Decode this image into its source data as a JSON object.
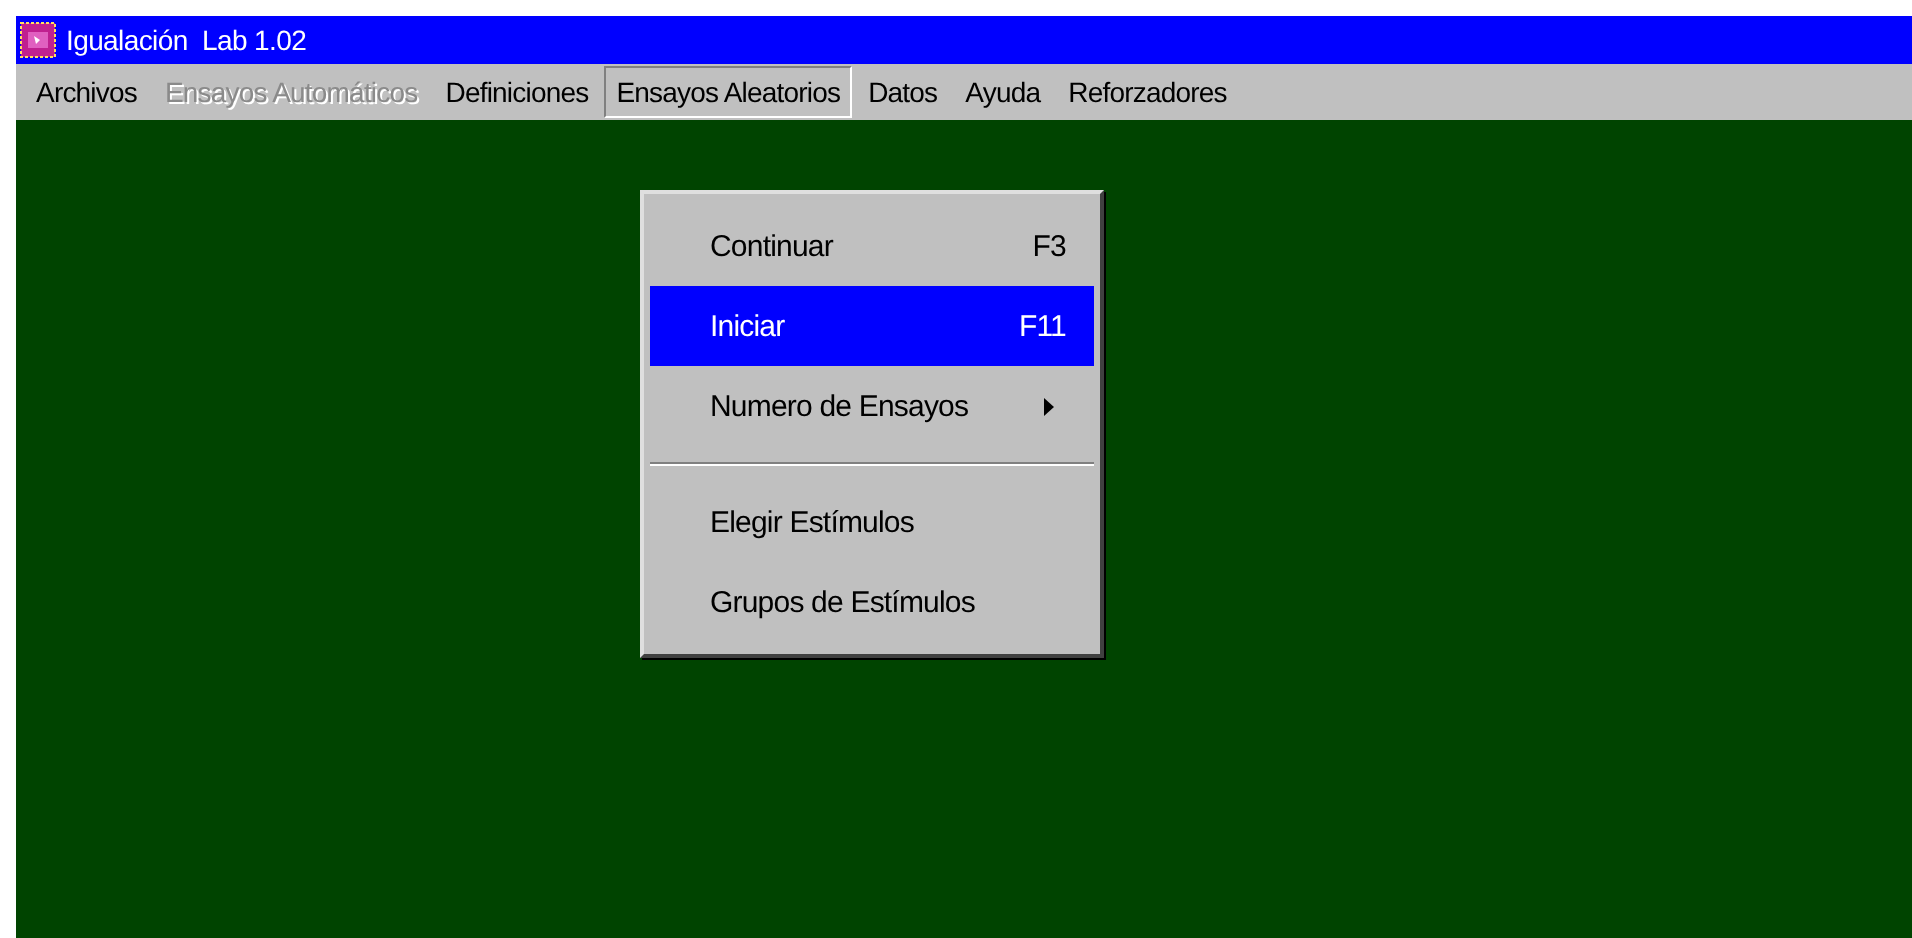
{
  "window": {
    "title": "Igualación  Lab 1.02"
  },
  "menu_bar": [
    {
      "label": "Archivos",
      "disabled": false,
      "selected": false
    },
    {
      "label": "Ensayos Automáticos",
      "disabled": true,
      "selected": false
    },
    {
      "label": "Definiciones",
      "disabled": false,
      "selected": false
    },
    {
      "label": "Ensayos Aleatorios",
      "disabled": false,
      "selected": true
    },
    {
      "label": "Datos",
      "disabled": false,
      "selected": false
    },
    {
      "label": "Ayuda",
      "disabled": false,
      "selected": false
    },
    {
      "label": "Reforzadores",
      "disabled": false,
      "selected": false
    }
  ],
  "dropdown": [
    {
      "kind": "item",
      "label": "Continuar",
      "shortcut": "F3",
      "selected": false
    },
    {
      "kind": "item",
      "label": "Iniciar",
      "shortcut": "F11",
      "selected": true
    },
    {
      "kind": "submenu",
      "label": "Numero de Ensayos",
      "selected": false
    },
    {
      "kind": "separator"
    },
    {
      "kind": "item",
      "label": "Elegir Estímulos",
      "selected": false
    },
    {
      "kind": "item",
      "label": "Grupos de Estímulos",
      "selected": false
    }
  ]
}
